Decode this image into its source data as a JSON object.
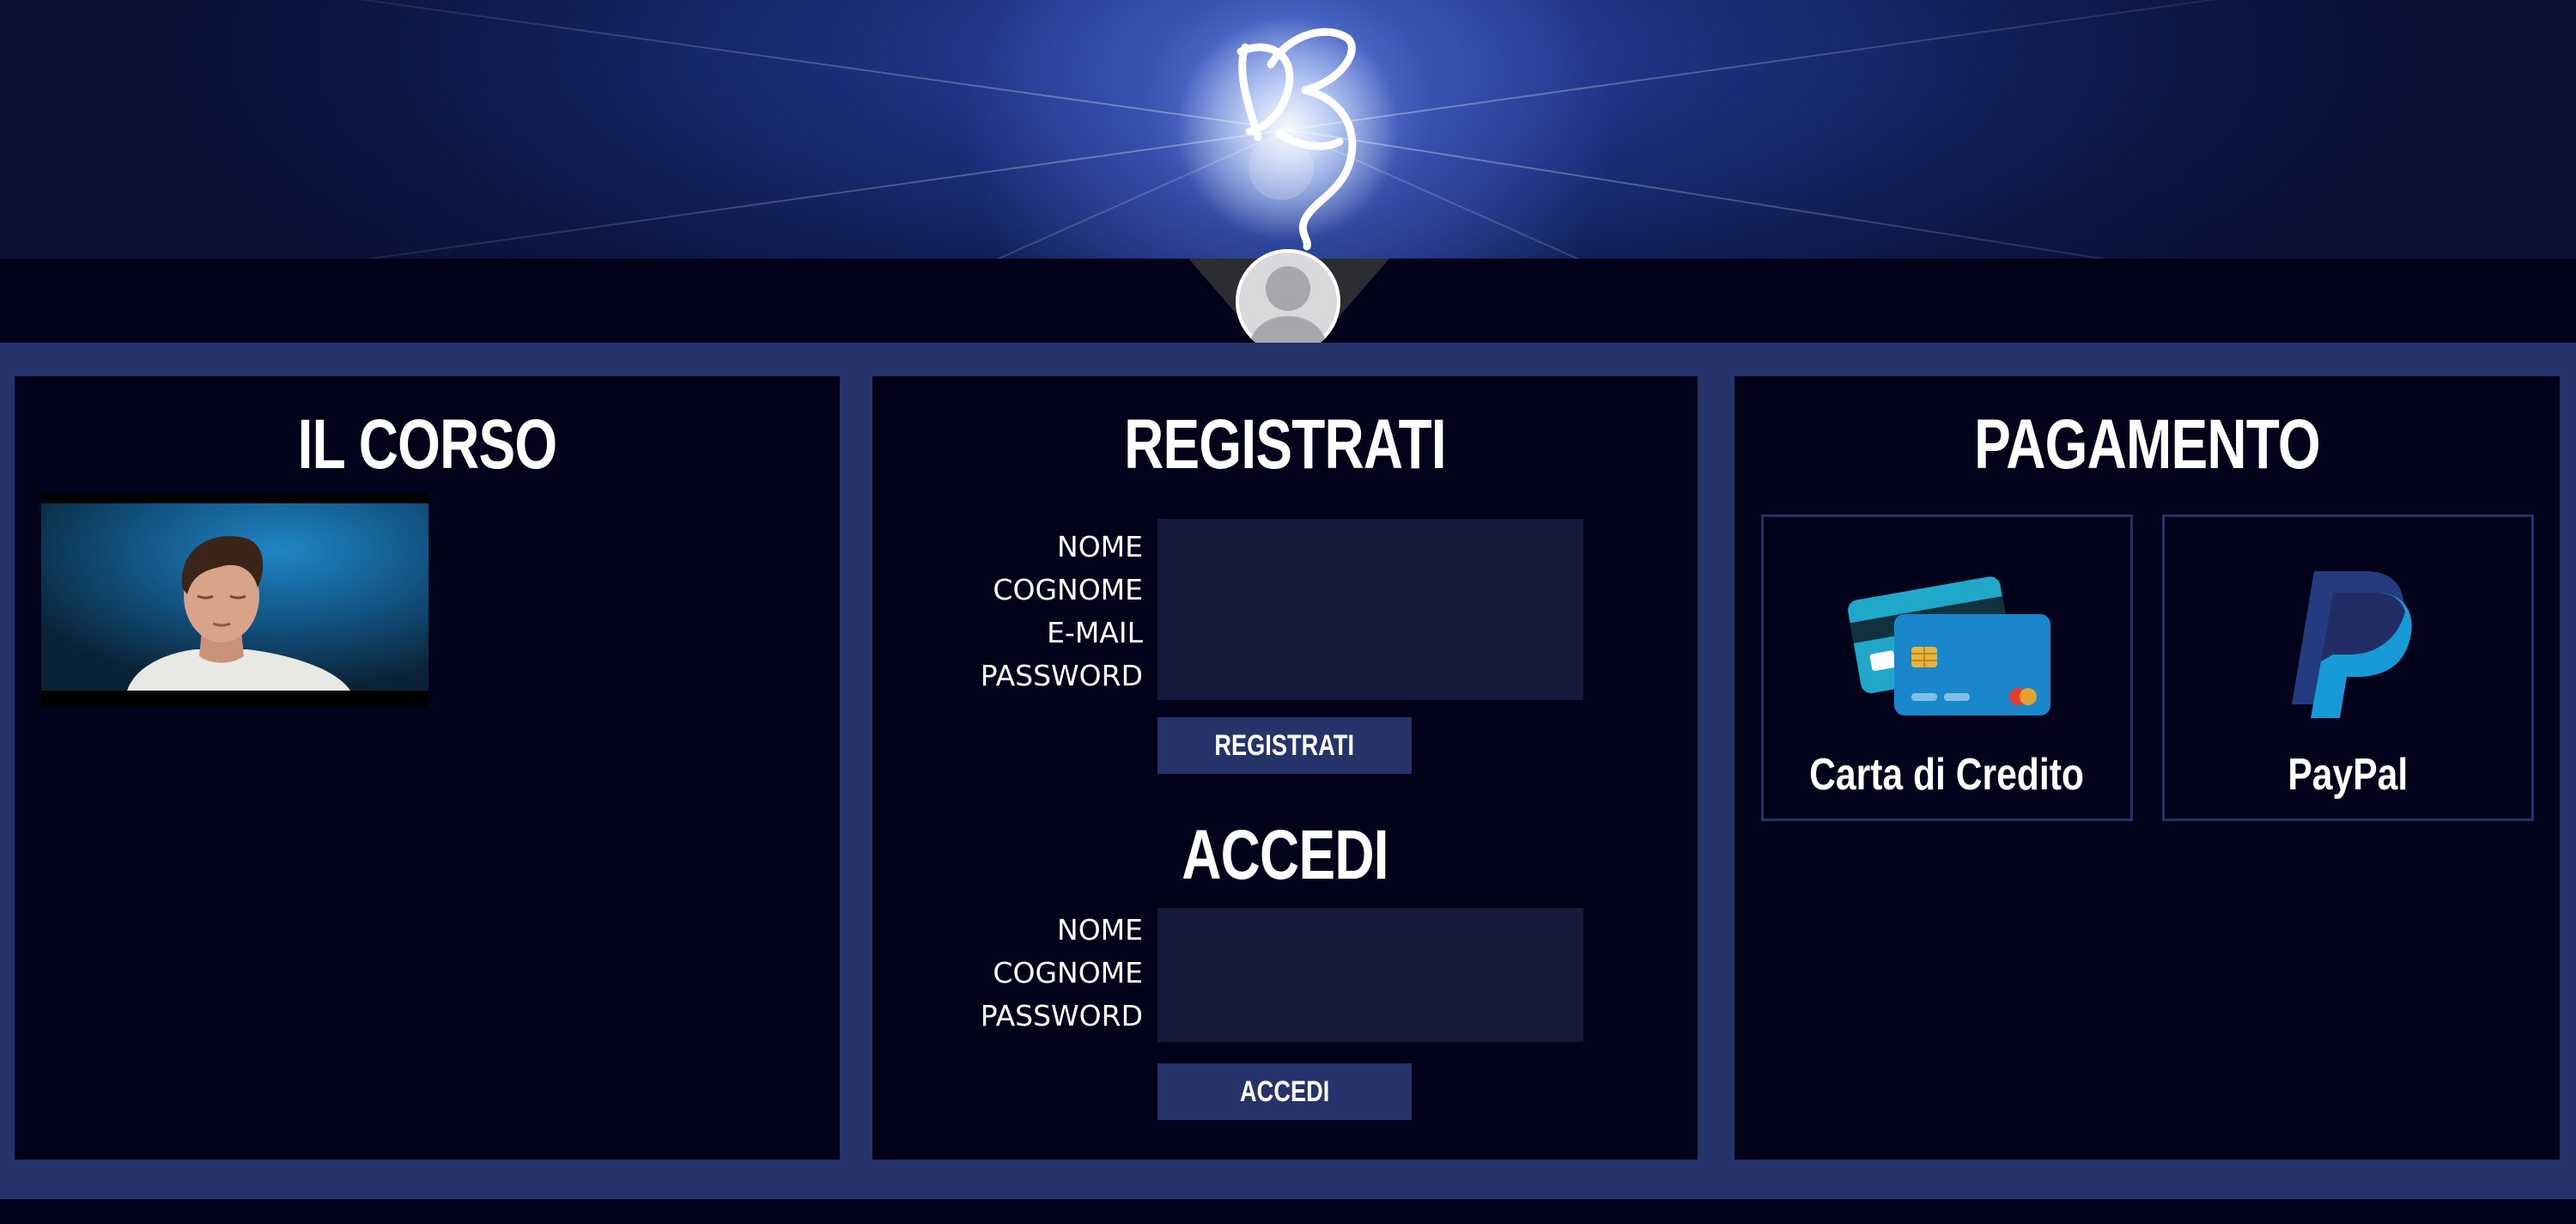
{
  "colors": {
    "page_background": "#02031a",
    "frame_blue": "#25336a",
    "input_background": "#151a3c",
    "text": "#ffffff"
  },
  "header": {
    "logo_icon": "butterfly-signature-logo",
    "avatar_icon": "user-avatar-icon"
  },
  "course": {
    "title": "IL CORSO",
    "video_thumbnail": "young-man-portrait-thumbnail"
  },
  "register": {
    "title": "REGISTRATI",
    "labels": [
      "NOME",
      "COGNOME",
      "E-MAIL",
      "PASSWORD"
    ],
    "button_label": "REGISTRATI"
  },
  "login": {
    "title": "ACCEDI",
    "labels": [
      "NOME",
      "COGNOME",
      "PASSWORD"
    ],
    "button_label": "ACCEDI"
  },
  "payment": {
    "title": "PAGAMENTO",
    "options": [
      {
        "label": "Carta di Credito",
        "icon": "credit-card-icon"
      },
      {
        "label": "PayPal",
        "icon": "paypal-icon"
      }
    ]
  }
}
